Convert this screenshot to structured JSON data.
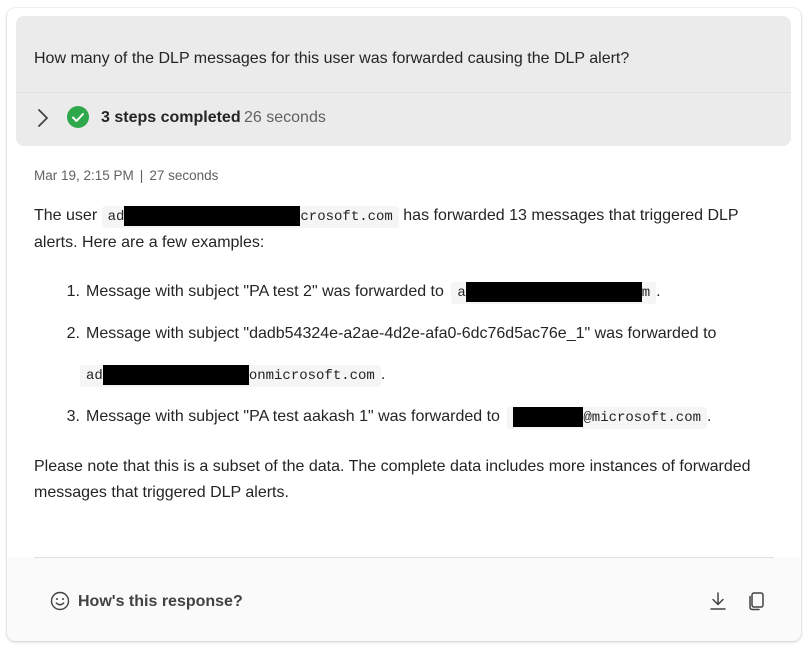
{
  "question": "How many of the DLP messages for this user was forwarded causing the DLP alert?",
  "steps": {
    "label": "3 steps completed",
    "duration": "26 seconds"
  },
  "response": {
    "date": "Mar 19, 2:15 PM",
    "separator": "|",
    "duration": "27 seconds",
    "intro_pre": "The user",
    "user_email_start": "ad",
    "user_email_end": "crosoft.com",
    "intro_post_line1": "has forwarded 13 messages that triggered DLP",
    "intro_post_line2": "alerts. Here are a few examples:",
    "items": [
      {
        "num": "1.",
        "text": "Message with subject \"PA test 2\" was forwarded to",
        "email_start": "a",
        "email_end": "m",
        "suffix": "."
      },
      {
        "num": "2.",
        "text": "Message with subject \"dadb54324e-a2ae-4d2e-afa0-6dc76d5ac76e_1\" was forwarded to",
        "email_start": "ad",
        "email_end": "onmicrosoft.com",
        "suffix": "."
      },
      {
        "num": "3.",
        "text": "Message with subject \"PA test aakash 1\" was forwarded to",
        "email_start": "",
        "email_end": "@microsoft.com",
        "suffix": "."
      }
    ],
    "note_line1": "Please note that this is a subset of the data. The complete data includes more instances of forwarded",
    "note_line2": "messages that triggered DLP alerts."
  },
  "feedback": {
    "label": "How's this response?"
  },
  "icons": {
    "expand": "chevron-right-icon",
    "success": "checkmark-circle-icon",
    "feedback": "emoji-smile-icon",
    "download": "download-icon",
    "copy": "copy-icon"
  },
  "colors": {
    "success": "#2ea84a",
    "panel": "#ebebeb",
    "redaction": "#000000"
  }
}
